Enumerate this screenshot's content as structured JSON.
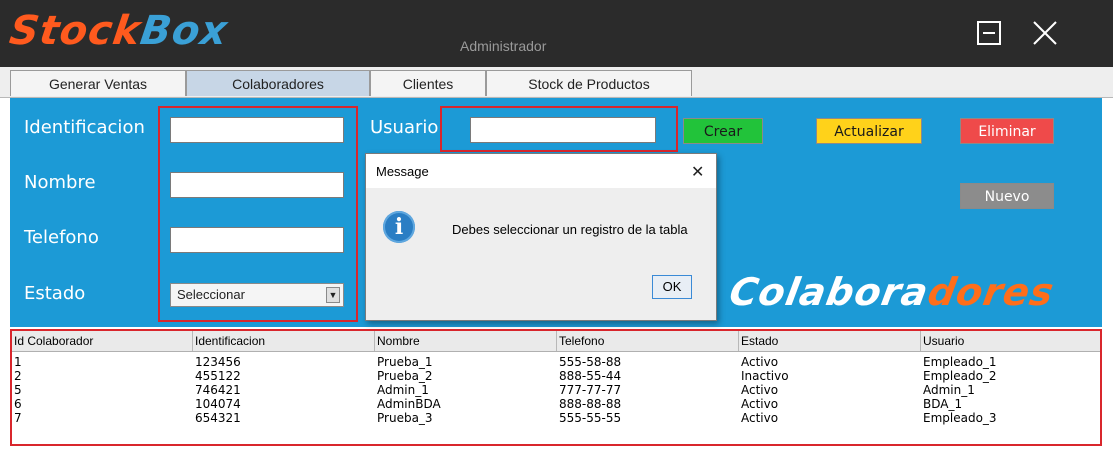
{
  "app": {
    "logo_part1": "Stock",
    "logo_part2": "Box",
    "window_title": "Administrador"
  },
  "tabs": [
    {
      "label": "Generar Ventas"
    },
    {
      "label": "Colaboradores"
    },
    {
      "label": "Clientes"
    },
    {
      "label": "Stock de Productos"
    }
  ],
  "form": {
    "identificacion_label": "Identificacion",
    "nombre_label": "Nombre",
    "telefono_label": "Telefono",
    "estado_label": "Estado",
    "usuario_label": "Usuario",
    "estado_selected": "Seleccionar",
    "identificacion_value": "",
    "nombre_value": "",
    "telefono_value": "",
    "usuario_value": ""
  },
  "buttons": {
    "crear": "Crear",
    "actualizar": "Actualizar",
    "eliminar": "Eliminar",
    "nuevo": "Nuevo"
  },
  "banner": {
    "part1": "Colabora",
    "part2": "dores"
  },
  "dialog": {
    "title": "Message",
    "message": "Debes seleccionar un registro de la tabla",
    "ok_label": "OK",
    "close_glyph": "✕"
  },
  "table": {
    "columns": [
      "Id Colaborador",
      "Identificacion",
      "Nombre",
      "Telefono",
      "Estado",
      "Usuario"
    ],
    "rows": [
      [
        "1",
        "123456",
        "Prueba_1",
        "555-58-88",
        "Activo",
        "Empleado_1"
      ],
      [
        "2",
        "455122",
        "Prueba_2",
        "888-55-44",
        "Inactivo",
        "Empleado_2"
      ],
      [
        "5",
        "746421",
        "Admin_1",
        "777-77-77",
        "Activo",
        "Admin_1"
      ],
      [
        "6",
        "104074",
        "AdminBDA",
        "888-88-88",
        "Activo",
        "BDA_1"
      ],
      [
        "7",
        "654321",
        "Prueba_3",
        "555-55-55",
        "Activo",
        "Empleado_3"
      ]
    ]
  },
  "colors": {
    "panel": "#1c9ad6",
    "crear": "#22c33a",
    "actualizar": "#ffd21a",
    "eliminar": "#ef4a4a",
    "nuevo": "#8c8c8c",
    "highlight": "#d9262c"
  },
  "icons": {
    "maximize": "maximize-icon",
    "close": "close-icon",
    "dialog_info": "info-icon",
    "dropdown": "chevron-down-icon"
  }
}
